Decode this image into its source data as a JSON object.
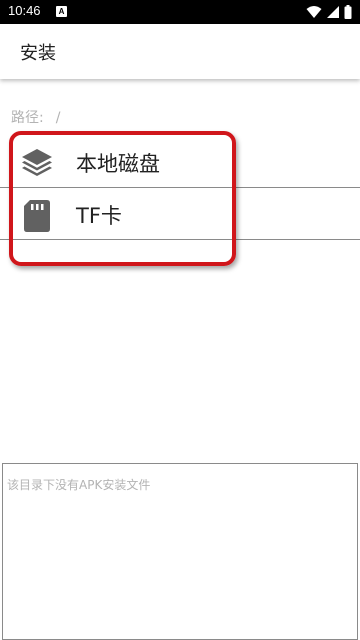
{
  "status_bar": {
    "time": "10:46",
    "notification_glyph": "A",
    "icons": [
      "wifi-icon",
      "signal-icon",
      "battery-icon"
    ]
  },
  "app_bar": {
    "title": "安装"
  },
  "path": {
    "label": "路径:",
    "value": "/"
  },
  "storage_items": [
    {
      "label": "本地磁盘",
      "icon": "layers-icon"
    },
    {
      "label": "TF卡",
      "icon": "sd-card-icon"
    }
  ],
  "file_box": {
    "empty_text": "该目录下没有APK安装文件"
  },
  "colors": {
    "highlight": "#d0161b",
    "icon": "#616161",
    "hint_text": "#b3b3b3"
  }
}
